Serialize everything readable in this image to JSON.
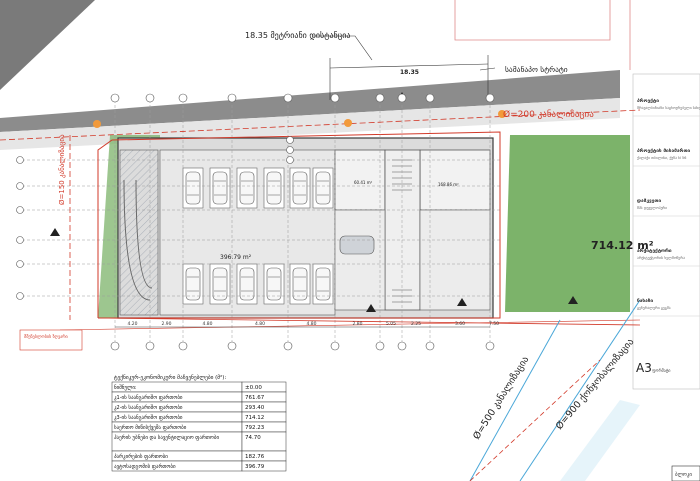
{
  "top_annotation": {
    "label": "18.35 მეტრიანი დისტანცია",
    "dimension": "18.35"
  },
  "street_label": "სამანაპო სტრატი",
  "pipes": {
    "top": "Ø=200 კანალიზაცია",
    "left": "Ø=150 კანალიზაცია",
    "diag1": "Ø=500 კანალიზაცია",
    "diag2": "Ø=900 ქონჯობალიზაცია"
  },
  "areas": {
    "green": "714.12 m²",
    "parking": "396.79 m²",
    "room1": "60.41 m²",
    "room2": "168.86 m²"
  },
  "bottom_dims": [
    "4.20",
    "2.90",
    "4.80",
    "4.80",
    "4.80",
    "2.80",
    "5.05",
    "2.25",
    "3.60",
    "7.50"
  ],
  "red_note": "მშენებლობის ზღვარი",
  "side_panel": {
    "items": [
      {
        "title": "პროექტი",
        "sub": "მრავალბინიანი საცხოვრებელი სახლი"
      },
      {
        "title": "პროექტის მისამართი",
        "sub": "ქალაქი თბილისი, ქუჩა N 56"
      },
      {
        "title": "დამკვეთი",
        "sub": "შპს დეველოპერი"
      },
      {
        "title": "არქიტექტორი",
        "sub": "არქიტექტორის ხელმოწერა"
      },
      {
        "title": "ნახაზი",
        "sub": "გენერალური გეგმა"
      }
    ],
    "sheet_size": "A3",
    "sheet_label": "ფორმატი"
  },
  "table": {
    "title": "ტექნიკურ-ეკონომიკური მაჩვენებლები (მ²):",
    "rows": [
      {
        "label": "ნიშნული:",
        "value": "±0.00"
      },
      {
        "label": "კ1-ის საანგარიშო ფართობი",
        "value": "761.67"
      },
      {
        "label": "კ2-ის საანგარიშო ფართობი",
        "value": "293.40"
      },
      {
        "label": "კ3-ის საანგარიშო ფართობი",
        "value": "714.12"
      },
      {
        "label": "საერთო მიწისქვეშა ფართობი",
        "value": "792.23"
      },
      {
        "label": "ჰაერის უბნები და სავენტილაციო ფართობი",
        "value": "74.70"
      },
      {
        "label": "პარკირების ფართობი",
        "value": "182.76"
      },
      {
        "label": "ავტოსადგომის ფართობი",
        "value": "396.79"
      }
    ]
  },
  "corner_stamp": "ბლოკი",
  "colors": {
    "road": "#8c8c8c",
    "green": "#7cb36a",
    "red": "#d23a2a",
    "line": "#3a3a3a",
    "grid": "#9a9a9a",
    "hatch": "#9aa0a8"
  }
}
